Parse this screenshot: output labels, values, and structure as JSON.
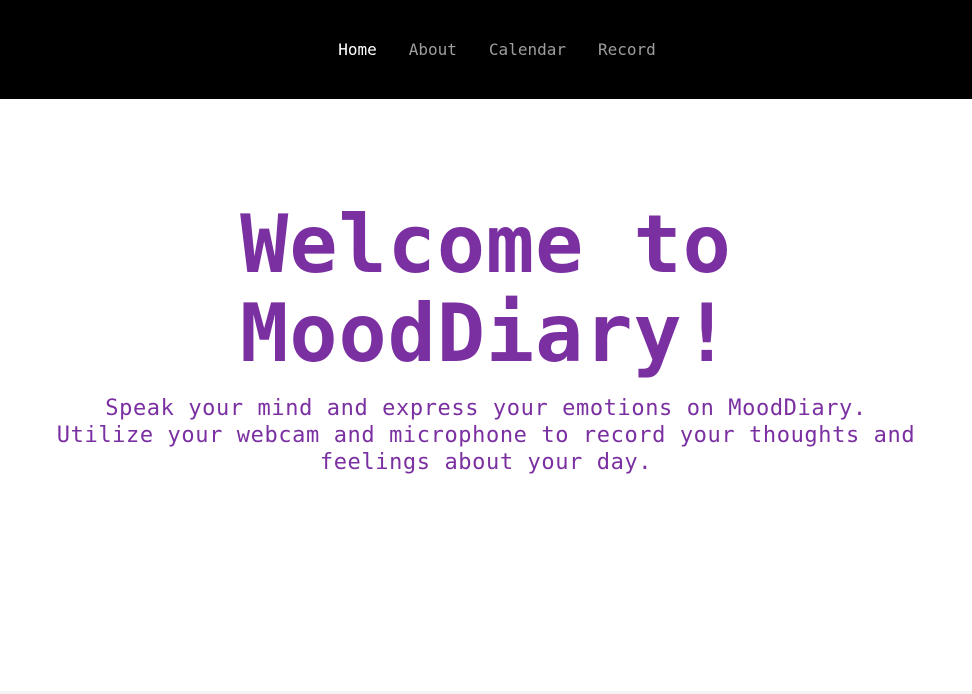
{
  "nav": {
    "items": [
      {
        "label": "Home",
        "active": true
      },
      {
        "label": "About",
        "active": false
      },
      {
        "label": "Calendar",
        "active": false
      },
      {
        "label": "Record",
        "active": false
      }
    ]
  },
  "hero": {
    "title_line1": "Welcome to",
    "title_line2": "MoodDiary!",
    "subtitle": "Speak your mind and express your emotions on MoodDiary. Utilize your webcam and microphone to record your thoughts and feelings about your day."
  },
  "colors": {
    "nav_bg": "#000000",
    "nav_active": "#ffffff",
    "nav_inactive": "#9d9d9d",
    "accent": "#7b30a1"
  }
}
